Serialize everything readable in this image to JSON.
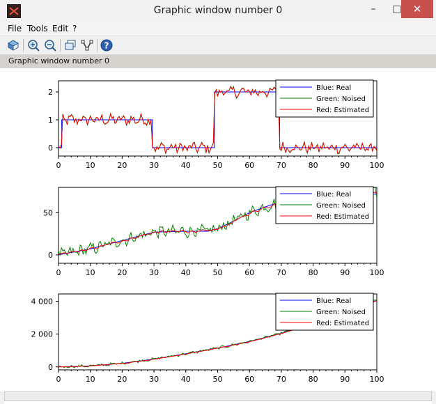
{
  "window": {
    "title": "Graphic window number 0",
    "info_label": "Graphic window number 0"
  },
  "menu": [
    "File",
    "Tools",
    "Edit",
    "?"
  ],
  "toolbar_icons": [
    "rotate-icon",
    "zoom-in-icon",
    "zoom-out-icon",
    "datatip-icon",
    "edit-curve-icon",
    "help-icon"
  ],
  "legend": [
    "Blue: Real",
    "Green: Noised",
    "Red: Estimated"
  ],
  "colors": {
    "real": "#0000ff",
    "noised": "#008000",
    "estimated": "#ff0000"
  },
  "chart_data": [
    {
      "type": "line",
      "x_range": [
        0,
        100
      ],
      "y_range": [
        -0.3,
        2.4
      ],
      "x_ticks": [
        "0",
        "10",
        "20",
        "30",
        "40",
        "50",
        "60",
        "70",
        "80",
        "90",
        "100"
      ],
      "y_ticks": [
        "0",
        "1",
        "2"
      ],
      "y_tick_values": [
        0,
        1,
        2
      ],
      "real": {
        "x": [
          0,
          1,
          1,
          29.5,
          29.5,
          49,
          49,
          69.5,
          69.5,
          100
        ],
        "y": [
          0,
          0,
          1,
          1,
          0,
          0,
          2,
          2,
          0,
          0
        ]
      },
      "noise_amp": 0.18,
      "legend": [
        "Blue: Real",
        "Green: Noised",
        "Red: Estimated"
      ]
    },
    {
      "type": "line",
      "x_range": [
        0,
        100
      ],
      "y_range": [
        -10,
        80
      ],
      "x_ticks": [
        "0",
        "10",
        "20",
        "30",
        "40",
        "50",
        "60",
        "70",
        "80",
        "90",
        "100"
      ],
      "y_ticks": [
        "0",
        "50"
      ],
      "y_tick_values": [
        0,
        50
      ],
      "real": {
        "x": [
          0,
          10,
          20,
          25,
          30,
          40,
          47,
          50,
          55,
          60,
          65,
          70,
          75,
          80,
          85,
          90,
          95,
          100
        ],
        "y": [
          0,
          7,
          17,
          22,
          27,
          28,
          28,
          31,
          40,
          50,
          57,
          63,
          70,
          72,
          72,
          72,
          72,
          72
        ]
      },
      "noise_amp": 6,
      "legend": [
        "Blue: Real",
        "Green: Noised",
        "Red: Estimated"
      ]
    },
    {
      "type": "line",
      "x_range": [
        0,
        100
      ],
      "y_range": [
        -180,
        4450
      ],
      "x_ticks": [
        "0",
        "10",
        "20",
        "30",
        "40",
        "50",
        "60",
        "70",
        "80",
        "90",
        "100"
      ],
      "y_ticks": [
        "0",
        "2 000",
        "4 000"
      ],
      "y_tick_values": [
        0,
        2000,
        4000
      ],
      "real": {
        "x": [
          0,
          10,
          20,
          30,
          40,
          50,
          60,
          70,
          80,
          90,
          100
        ],
        "y": [
          0,
          60,
          220,
          480,
          800,
          1150,
          1550,
          2050,
          2700,
          3400,
          4050
        ]
      },
      "noise_amp": 70,
      "legend": [
        "Blue: Real",
        "Green: Noised",
        "Red: Estimated"
      ]
    }
  ]
}
